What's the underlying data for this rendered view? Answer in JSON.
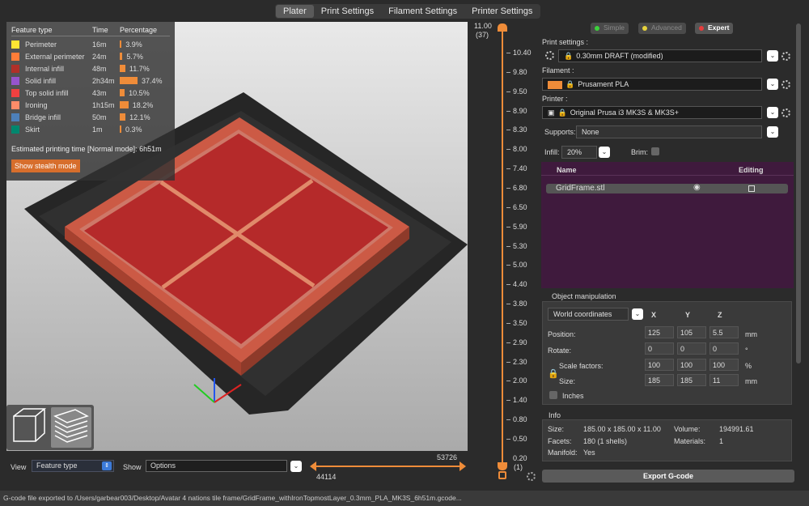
{
  "tabs": [
    "Plater",
    "Print Settings",
    "Filament Settings",
    "Printer Settings"
  ],
  "legend": {
    "headers": [
      "Feature type",
      "Time",
      "Percentage"
    ],
    "rows": [
      {
        "name": "Perimeter",
        "time": "16m",
        "pct": "3.9%",
        "value": 3.9,
        "color": "#ffe633"
      },
      {
        "name": "External perimeter",
        "time": "24m",
        "pct": "5.7%",
        "value": 5.7,
        "color": "#ff7d38"
      },
      {
        "name": "Internal infill",
        "time": "48m",
        "pct": "11.7%",
        "value": 11.7,
        "color": "#b03029"
      },
      {
        "name": "Solid infill",
        "time": "2h34m",
        "pct": "37.4%",
        "value": 37.4,
        "color": "#9654cc"
      },
      {
        "name": "Top solid infill",
        "time": "43m",
        "pct": "10.5%",
        "value": 10.5,
        "color": "#f04040"
      },
      {
        "name": "Ironing",
        "time": "1h15m",
        "pct": "18.2%",
        "value": 18.2,
        "color": "#ff8c69"
      },
      {
        "name": "Bridge infill",
        "time": "50m",
        "pct": "12.1%",
        "value": 12.1,
        "color": "#4d80ba"
      },
      {
        "name": "Skirt",
        "time": "1m",
        "pct": "0.3%",
        "value": 0.3,
        "color": "#00876e"
      }
    ],
    "est_label": "Estimated printing time [Normal mode]:",
    "est_value": "6h51m",
    "stealth": "Show stealth mode"
  },
  "bottom": {
    "view_label": "View",
    "view_value": "Feature type",
    "show_label": "Show",
    "show_value": "Options",
    "h_min": "44114",
    "h_max": "53726"
  },
  "slider": {
    "top_value": "11.00",
    "top_layer": "(37)",
    "bottom_value": "0.20",
    "bottom_layer": "(1)",
    "ticks": [
      "10.40",
      "9.80",
      "9.50",
      "8.90",
      "8.30",
      "8.00",
      "7.40",
      "6.80",
      "6.50",
      "5.90",
      "5.30",
      "5.00",
      "4.40",
      "3.80",
      "3.50",
      "2.90",
      "2.30",
      "2.00",
      "1.40",
      "0.80",
      "0.50"
    ]
  },
  "panel": {
    "modes": [
      "Simple",
      "Advanced",
      "Expert"
    ],
    "mode_colors": [
      "#3cd13c",
      "#e6d23c",
      "#e63c3c"
    ],
    "print_label": "Print settings :",
    "print_value": "0.30mm DRAFT (modified)",
    "filament_label": "Filament :",
    "filament_value": "Prusament PLA",
    "filament_color": "#ef8c39",
    "printer_label": "Printer :",
    "printer_value": "Original Prusa i3 MK3S & MK3S+",
    "supports_label": "Supports:",
    "supports_value": "None",
    "infill_label": "Infill:",
    "infill_value": "20%",
    "brim_label": "Brim:",
    "list_name": "Name",
    "list_editing": "Editing",
    "object_name": "GridFrame.stl",
    "om_title": "Object manipulation",
    "coords": "World coordinates",
    "axes": [
      "X",
      "Y",
      "Z"
    ],
    "position_label": "Position:",
    "position": [
      "125",
      "105",
      "5.5"
    ],
    "pos_unit": "mm",
    "rotate_label": "Rotate:",
    "rotate": [
      "0",
      "0",
      "0"
    ],
    "rot_unit": "°",
    "scale_label": "Scale factors:",
    "scale": [
      "100",
      "100",
      "100"
    ],
    "scale_unit": "%",
    "size_label": "Size:",
    "size": [
      "185",
      "185",
      "11"
    ],
    "size_unit": "mm",
    "inches": "Inches",
    "info_title": "Info",
    "size_info_label": "Size:",
    "size_info": "185.00 x 185.00 x 11.00",
    "volume_label": "Volume:",
    "volume": "194991.61",
    "facets_label": "Facets:",
    "facets": "180 (1 shells)",
    "materials_label": "Materials:",
    "materials": "1",
    "manifold_label": "Manifold:",
    "manifold": "Yes",
    "export": "Export G-code"
  },
  "status": "G-code file exported to /Users/garbear003/Desktop/Avatar 4 nations tile frame/GridFrame_withIronTopmostLayer_0.3mm_PLA_MK3S_6h51m.gcode..."
}
